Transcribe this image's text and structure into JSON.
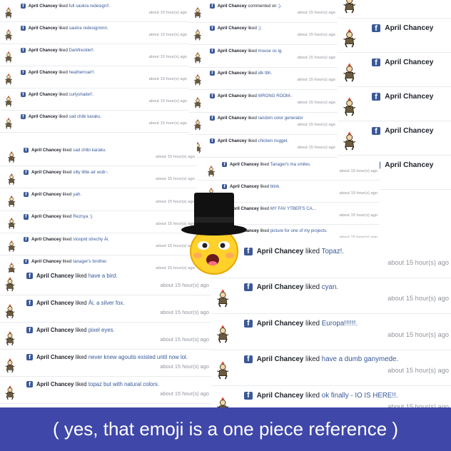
{
  "user": "April Chancey",
  "time_text": "about 15 hour(s) ago",
  "fb_glyph": "f",
  "colors": {
    "fb_blue": "#3b5998",
    "link": "#365899",
    "caption_bg": "#3f47a8"
  },
  "panel_a": [
    {
      "verb": "liked",
      "object": "full saukra redesign!!."
    },
    {
      "verb": "liked",
      "object": "saukra redesignnnn."
    },
    {
      "verb": "liked",
      "object": "Darkfreckle!!."
    },
    {
      "verb": "liked",
      "object": "heatherroar!!."
    },
    {
      "verb": "liked",
      "object": "curlyshade!!."
    },
    {
      "verb": "liked",
      "object": "sad chibi karaku."
    }
  ],
  "panel_b": [
    {
      "verb": "liked",
      "object": "sad chibi karaku."
    },
    {
      "verb": "liked",
      "object": "silly little air wub~."
    },
    {
      "verb": "liked",
      "object": "yah."
    },
    {
      "verb": "liked",
      "object": "Reznya :)."
    },
    {
      "verb": "liked",
      "object": "stoopid strechy Ài."
    },
    {
      "verb": "liked",
      "object": "tanager's brother."
    }
  ],
  "panel_c": [
    {
      "verb": "liked",
      "object": "have a bird."
    },
    {
      "verb": "liked",
      "object": "Ài, a silver fox."
    },
    {
      "verb": "liked",
      "object": "pixel eyes."
    },
    {
      "verb": "liked",
      "object": "never knew agoutis existed until now lol."
    },
    {
      "verb": "liked",
      "object": "topaz but with natural colors."
    }
  ],
  "panel_d": [
    {
      "verb": "commented on",
      "object": ";)."
    },
    {
      "verb": "liked",
      "object": ";)."
    },
    {
      "verb": "liked",
      "object": "mouse oc ig."
    },
    {
      "verb": "liked",
      "object": "idk tbh."
    },
    {
      "verb": "liked",
      "object": "WRONG ROOM-."
    },
    {
      "verb": "liked",
      "object": "random color generator"
    },
    {
      "verb": "liked",
      "object": "chicken nugget."
    }
  ],
  "panel_e": [
    {
      "verb": "liked",
      "object": "Tanager's ma smiles."
    },
    {
      "verb": "liked",
      "object": "blink."
    },
    {
      "verb": "liked",
      "object": "MY FAV YTBER'S CA..."
    },
    {
      "verb": "liked",
      "object": "picture for one of my projects."
    }
  ],
  "panel_f": [
    {
      "verb": "",
      "object": ""
    },
    {
      "verb": "",
      "object": ""
    },
    {
      "verb": "",
      "object": ""
    },
    {
      "verb": "",
      "object": ""
    },
    {
      "verb": "",
      "object": ""
    },
    {
      "verb": "",
      "object": ""
    }
  ],
  "panel_g": [
    {
      "verb": "liked",
      "object": "Topaz!."
    },
    {
      "verb": "liked",
      "object": "cyan."
    },
    {
      "verb": "liked",
      "object": "Europa!!!!!!."
    },
    {
      "verb": "liked",
      "object": "have a dumb ganymede."
    },
    {
      "verb": "liked",
      "object": "ok finally - IO IS HERE!!."
    }
  ],
  "caption": "( yes, that emoji is a one piece reference )"
}
